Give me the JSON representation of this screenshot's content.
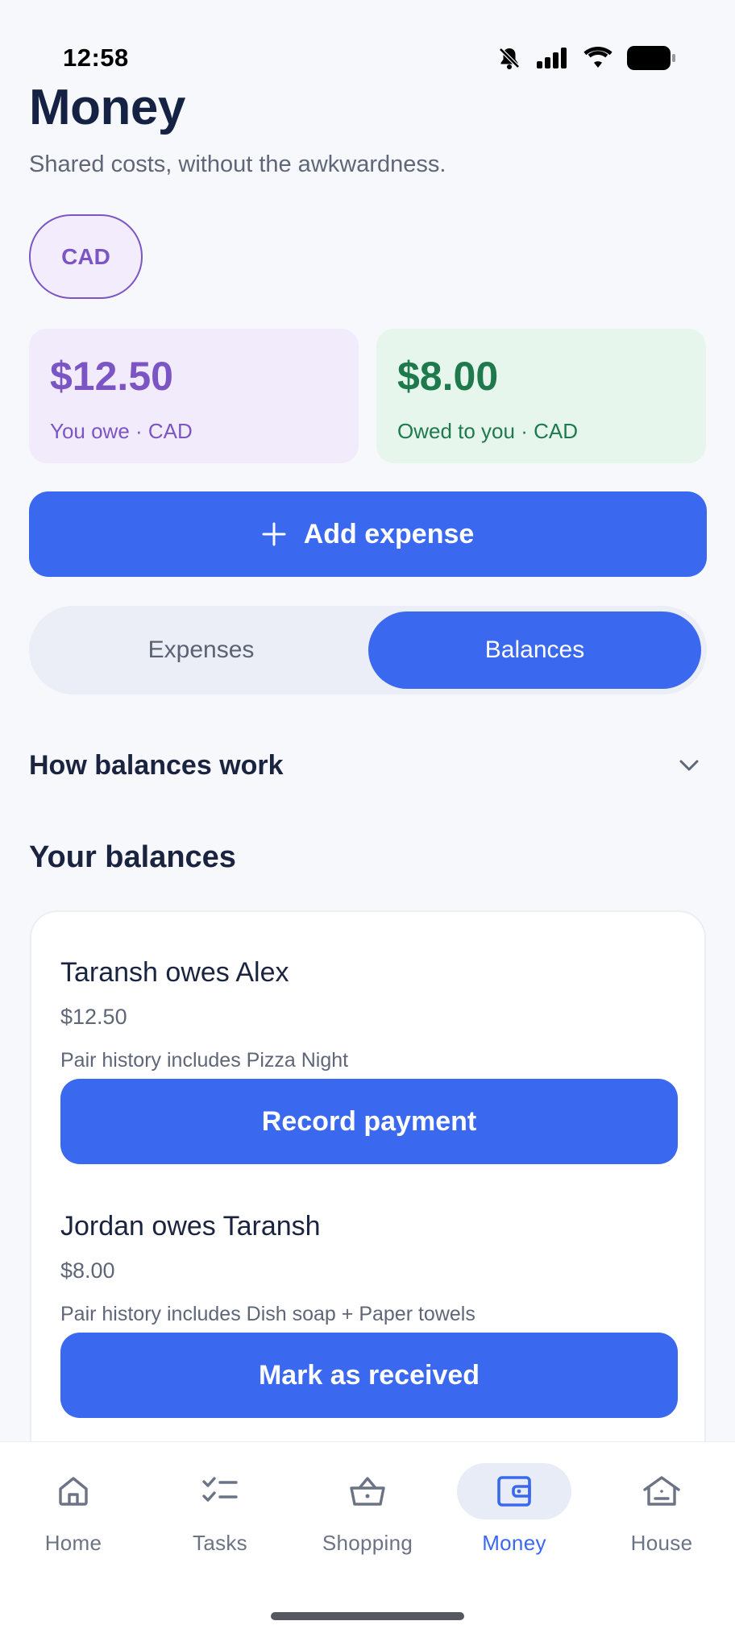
{
  "status_bar": {
    "time": "12:58"
  },
  "header": {
    "title": "Money",
    "subtitle": "Shared costs, without the awkwardness."
  },
  "currency": {
    "label": "CAD"
  },
  "summary": {
    "owe": {
      "amount": "$12.50",
      "label": "You owe · CAD"
    },
    "owed": {
      "amount": "$8.00",
      "label": "Owed to you · CAD"
    }
  },
  "add_expense": {
    "label": "Add expense"
  },
  "segmented": {
    "tabs": [
      {
        "label": "Expenses",
        "selected": false
      },
      {
        "label": "Balances",
        "selected": true
      }
    ]
  },
  "how_balances": {
    "label": "How balances work"
  },
  "balances_section": {
    "title": "Your balances"
  },
  "balances": [
    {
      "title": "Taransh owes Alex",
      "amount": "$12.50",
      "note": "Pair history includes Pizza Night",
      "action": "Record payment"
    },
    {
      "title": "Jordan owes Taransh",
      "amount": "$8.00",
      "note": "Pair history includes Dish soap + Paper towels",
      "action": "Mark as received"
    }
  ],
  "nav": {
    "items": [
      {
        "label": "Home",
        "icon": "home-icon"
      },
      {
        "label": "Tasks",
        "icon": "tasks-icon"
      },
      {
        "label": "Shopping",
        "icon": "basket-icon"
      },
      {
        "label": "Money",
        "icon": "wallet-icon",
        "active": true
      },
      {
        "label": "House",
        "icon": "house-icon"
      }
    ]
  },
  "colors": {
    "primary": "#3a68ee",
    "owe": "#7c55c4",
    "owed": "#1e7a4c",
    "text": "#1a2340",
    "muted": "#5e6678"
  }
}
